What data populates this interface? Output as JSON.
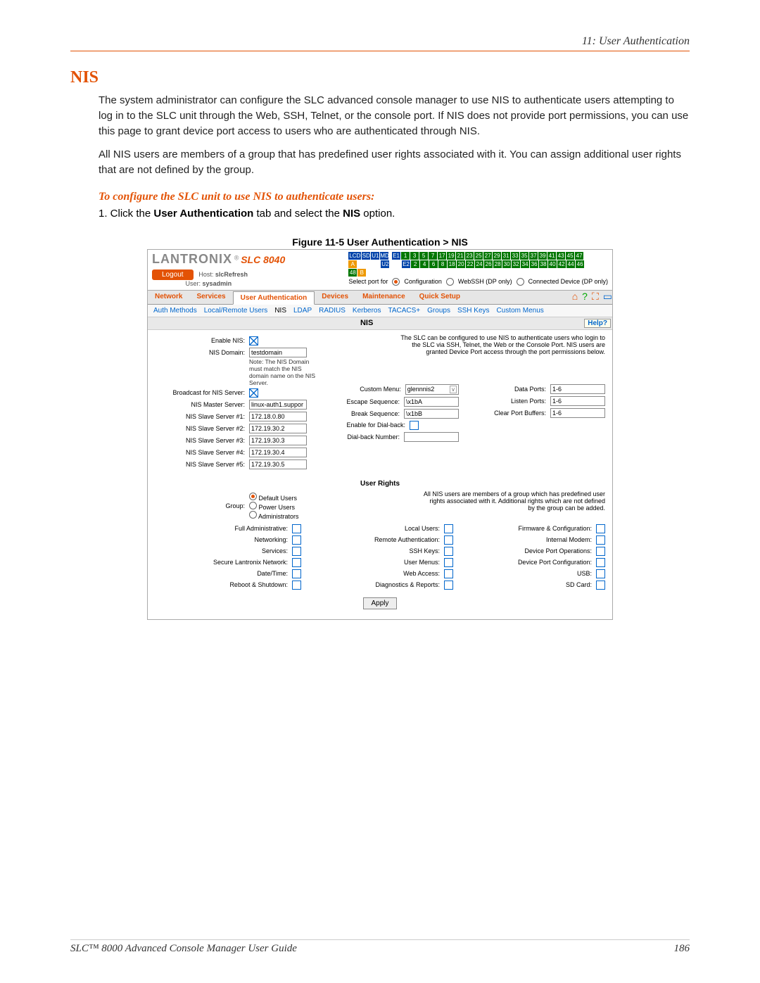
{
  "doc": {
    "chapter": "11: User Authentication",
    "section": "NIS",
    "para1": "The system administrator can configure the SLC advanced console manager to use NIS to authenticate users attempting to log in to the SLC unit through the Web, SSH, Telnet, or the console port. If NIS does not provide port permissions, you can use this page to grant device port access to users who are authenticated through NIS.",
    "para2": "All NIS users are members of a group that has predefined user rights associated with it. You can assign additional user rights that are not defined by the group.",
    "subhead": "To configure the SLC unit to use NIS to authenticate users:",
    "step1_pre": "1.  Click the ",
    "step1_b1": "User Authentication",
    "step1_mid": " tab and select the ",
    "step1_b2": "NIS",
    "step1_post": " option.",
    "figcap": "Figure 11-5  User Authentication > NIS",
    "footer_left": "SLC™ 8000 Advanced Console Manager User Guide",
    "footer_right": "186"
  },
  "app": {
    "brand": "LANTRONIX",
    "model": "SLC 8040",
    "logout": "Logout",
    "host_lbl": "Host:",
    "host": "slcRefresh",
    "user_lbl": "User:",
    "user": "sysadmin",
    "portbar": {
      "lcd": "LCD",
      "sd": "SD",
      "u1": "U1",
      "md": "MD",
      "u2": "U2",
      "e1": "E1",
      "e2": "E2",
      "row1": [
        "1",
        "3",
        "5",
        "7",
        "17",
        "19",
        "21",
        "23",
        "25",
        "27",
        "29",
        "31",
        "33",
        "35",
        "37",
        "39",
        "41",
        "43",
        "45",
        "47"
      ],
      "row2": [
        "2",
        "4",
        "6",
        "8",
        "18",
        "20",
        "22",
        "24",
        "26",
        "28",
        "30",
        "32",
        "34",
        "36",
        "38",
        "40",
        "42",
        "44",
        "46",
        "48"
      ],
      "a": "A",
      "b": "B"
    },
    "selectport": {
      "label": "Select port for",
      "opt1": "Configuration",
      "opt2": "WebSSH (DP only)",
      "opt3": "Connected Device (DP only)"
    },
    "tabs": {
      "t1": "Network",
      "t2": "Services",
      "t3": "User Authentication",
      "t4": "Devices",
      "t5": "Maintenance",
      "t6": "Quick Setup"
    },
    "subtabs": {
      "s1": "Auth Methods",
      "s2": "Local/Remote Users",
      "s3": "NIS",
      "s4": "LDAP",
      "s5": "RADIUS",
      "s6": "Kerberos",
      "s7": "TACACS+",
      "s8": "Groups",
      "s9": "SSH Keys",
      "s10": "Custom Menus"
    },
    "panel_title": "NIS",
    "help": "Help?",
    "info": "The SLC can be configured to use NIS to authenticate users who login to the SLC via SSH, Telnet, the Web or the Console Port. NIS users are granted Device Port access through the port permissions below.",
    "fields": {
      "enable_nis": "Enable NIS:",
      "nis_domain": "NIS Domain:",
      "nis_domain_val": "testdomain",
      "note": "Note: The NIS Domain must match the NIS domain name on the NIS Server.",
      "broadcast": "Broadcast for NIS Server:",
      "master": "NIS Master Server:",
      "master_val": "linux-auth1.suppor",
      "s1": "NIS Slave Server #1:",
      "s1v": "172.18.0.80",
      "s2": "NIS Slave Server #2:",
      "s2v": "172.19.30.2",
      "s3": "NIS Slave Server #3:",
      "s3v": "172.19.30.3",
      "s4": "NIS Slave Server #4:",
      "s4v": "172.19.30.4",
      "s5": "NIS Slave Server #5:",
      "s5v": "172.19.30.5",
      "cmenu": "Custom Menu:",
      "cmenu_val": "glennnis2",
      "esc": "Escape Sequence:",
      "esc_val": "\\x1bA",
      "brk": "Break Sequence:",
      "brk_val": "\\x1bB",
      "dialen": "Enable for Dial-back:",
      "dialnum": "Dial-back Number:",
      "dialnum_val": "",
      "dports": "Data Ports:",
      "dports_val": "1-6",
      "lports": "Listen Ports:",
      "lports_val": "1-6",
      "cports": "Clear Port Buffers:",
      "cports_val": "1-6"
    },
    "ur": {
      "title": "User Rights",
      "group_lbl": "Group:",
      "g1": "Default Users",
      "g2": "Power Users",
      "g3": "Administrators",
      "info": "All NIS users are members of a group which has predefined user rights associated with it. Additional rights which are not defined by the group can be added.",
      "r": {
        "fulladmin": "Full Administrative:",
        "net": "Networking:",
        "svc": "Services:",
        "sln": "Secure Lantronix Network:",
        "dt": "Date/Time:",
        "rs": "Reboot & Shutdown:",
        "lu": "Local Users:",
        "ra": "Remote Authentication:",
        "sk": "SSH Keys:",
        "um": "User Menus:",
        "wa": "Web Access:",
        "dr": "Diagnostics & Reports:",
        "fc": "Firmware & Configuration:",
        "im": "Internal Modem:",
        "dpo": "Device Port Operations:",
        "dpc": "Device Port Configuration:",
        "usb": "USB:",
        "sd": "SD Card:"
      },
      "apply": "Apply"
    }
  }
}
